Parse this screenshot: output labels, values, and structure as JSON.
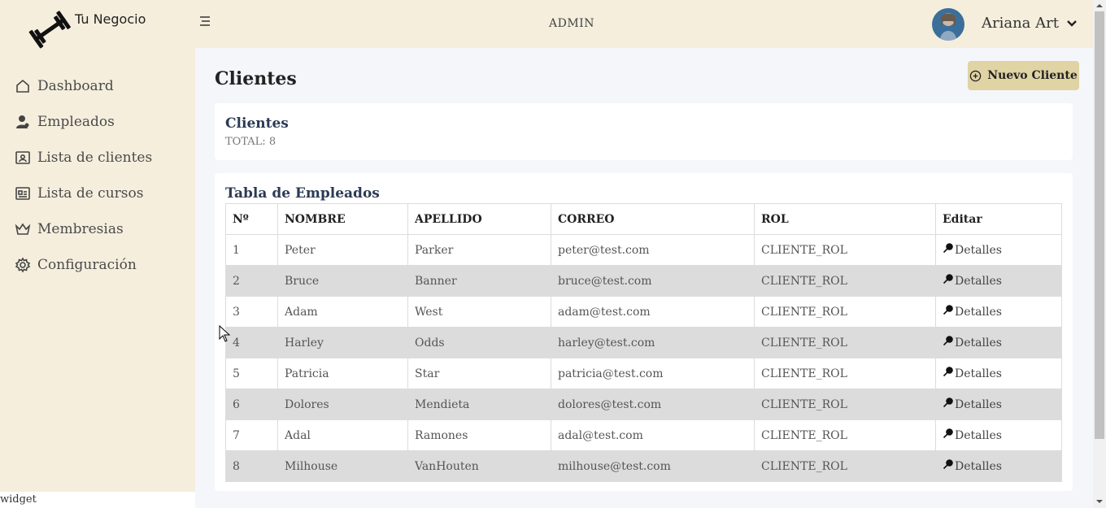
{
  "brand": {
    "name": "Tu Negocio",
    "logo_icon": "dumbbell-icon"
  },
  "sidebar": {
    "items": [
      {
        "label": "Dashboard",
        "icon": "home-icon"
      },
      {
        "label": "Empleados",
        "icon": "user-icon"
      },
      {
        "label": "Lista de clientes",
        "icon": "contact-card-icon"
      },
      {
        "label": "Lista de cursos",
        "icon": "list-card-icon"
      },
      {
        "label": "Membresias",
        "icon": "crown-icon"
      },
      {
        "label": "Configuración",
        "icon": "gear-icon"
      }
    ],
    "footer_label": "widget"
  },
  "topbar": {
    "title": "ADMIN",
    "user_name": "Ariana Art"
  },
  "page": {
    "title": "Clientes",
    "new_button_label": "Nuevo Cliente"
  },
  "summary": {
    "title": "Clientes",
    "total": "TOTAL: 8"
  },
  "table": {
    "title": "Tabla de Empleados",
    "headers": [
      "Nº",
      "NOMBRE",
      "APELLIDO",
      "CORREO",
      "ROL",
      "Editar"
    ],
    "detail_label": "Detalles",
    "rows": [
      {
        "n": "1",
        "nombre": "Peter",
        "apellido": "Parker",
        "correo": "peter@test.com",
        "rol": "CLIENTE_ROL"
      },
      {
        "n": "2",
        "nombre": "Bruce",
        "apellido": "Banner",
        "correo": "bruce@test.com",
        "rol": "CLIENTE_ROL"
      },
      {
        "n": "3",
        "nombre": "Adam",
        "apellido": "West",
        "correo": "adam@test.com",
        "rol": "CLIENTE_ROL"
      },
      {
        "n": "4",
        "nombre": "Harley",
        "apellido": "Odds",
        "correo": "harley@test.com",
        "rol": "CLIENTE_ROL"
      },
      {
        "n": "5",
        "nombre": "Patricia",
        "apellido": "Star",
        "correo": "patricia@test.com",
        "rol": "CLIENTE_ROL"
      },
      {
        "n": "6",
        "nombre": "Dolores",
        "apellido": "Mendieta",
        "correo": "dolores@test.com",
        "rol": "CLIENTE_ROL"
      },
      {
        "n": "7",
        "nombre": "Adal",
        "apellido": "Ramones",
        "correo": "adal@test.com",
        "rol": "CLIENTE_ROL"
      },
      {
        "n": "8",
        "nombre": "Milhouse",
        "apellido": "VanHouten",
        "correo": "milhouse@test.com",
        "rol": "CLIENTE_ROL"
      }
    ]
  },
  "colors": {
    "sidebar_bg": "#f5eedd",
    "button_bg": "#e0d3a4",
    "stripe_row": "#dcdcdc",
    "heading": "#2b3a55"
  }
}
